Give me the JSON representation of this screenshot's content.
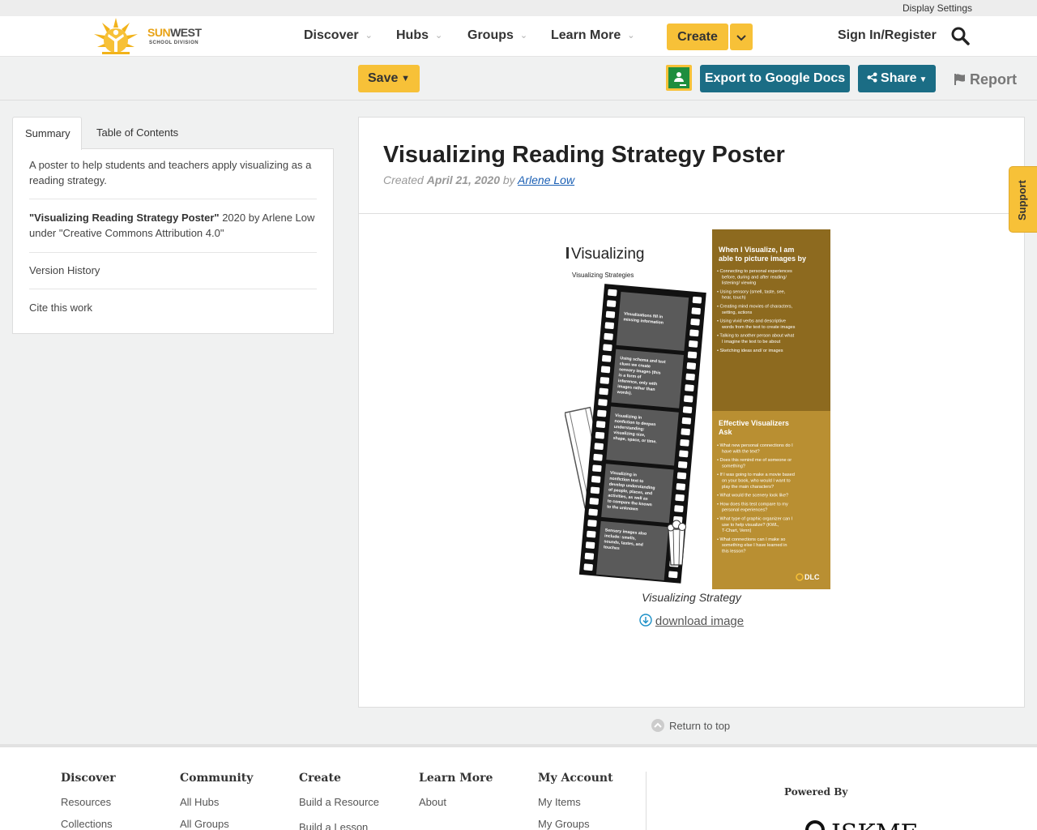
{
  "util_bar": {
    "display_settings": "Display Settings"
  },
  "header": {
    "brand_sun": "SUN",
    "brand_west": "WEST",
    "brand_sub": "SCHOOL DIVISION",
    "nav": [
      {
        "label": "Discover"
      },
      {
        "label": "Hubs"
      },
      {
        "label": "Groups"
      },
      {
        "label": "Learn More"
      }
    ],
    "create_label": "Create",
    "signin_label": "Sign In/Register"
  },
  "toolbar": {
    "save_label": "Save",
    "export_label": "Export to Google Docs",
    "share_label": "Share",
    "report_label": "Report"
  },
  "sidebar": {
    "tabs": [
      {
        "label": "Summary",
        "active": true
      },
      {
        "label": "Table of Contents",
        "active": false
      }
    ],
    "summary": "A poster to help students and teachers apply visualizing as a reading strategy.",
    "attribution_title": "\"Visualizing Reading Strategy Poster\"",
    "attribution_rest": " 2020 by Arlene Low under \"Creative Commons Attribution 4.0\"",
    "version_history": "Version History",
    "cite": "Cite this work"
  },
  "main": {
    "title": "Visualizing Reading Strategy Poster",
    "created_prefix": "Created ",
    "created_date": "April 21, 2020",
    "by": " by ",
    "author": "Arlene Low",
    "image_caption": "Visualizing Strategy",
    "download_label": "download image",
    "return_top": "Return to top"
  },
  "poster": {
    "title": "Visualizing",
    "subtitle": "Visualizing Strategies",
    "film_frames": [
      "Visualizations fill in missing information",
      "Using schema and text clues we create sensory images (this is a form of inference, only with images rather than words).",
      "Visualizing in nonfiction to deepen understanding: visualizing size, shape, space, or time.",
      "Visualizing in nonfiction text to develop understanding of people, places, and activities, as well as to compare the known to the unknown",
      "Sensory images also include: smells, sounds, tastes, and touches"
    ],
    "panel1_heading": "When I Visualize, I am able to picture images by",
    "panel1_items": [
      "Connecting to personal experiences before, during and after reading/ listening/ viewing",
      "Using sensory (smell, taste, see, hear, touch)",
      "Creating mind movies of characters, setting, actions",
      "Using vivid verbs and descriptive words from the text to create images",
      "Talking to another person about what I imagine the text to be about",
      "Sketching ideas and/ or images"
    ],
    "panel2_heading": "Effective Visualizers Ask",
    "panel2_items": [
      "What new personal connections do I have with the text?",
      "Does this remind me of someone or something?",
      "If I was going to make a movie based on your book, who would I want to play the main characters?",
      "What would the scenery look like?",
      "How does this test compare to my personal experiences?",
      "What type of graphic organizer can I use to help visualize? (KWL, T-Chart, Venn)",
      "What connections can I make so something else I have learned in this lesson?"
    ],
    "badge": "DLC",
    "panel1_color": "#8d6a1f",
    "panel2_color": "#b98f32"
  },
  "support_label": "Support",
  "footer": {
    "columns": [
      {
        "heading": "Discover",
        "links": [
          "Resources",
          "Collections"
        ]
      },
      {
        "heading": "Community",
        "links": [
          "All Hubs",
          "All Groups"
        ]
      },
      {
        "heading": "Create",
        "links": [
          "Build a Resource",
          "Build a Lesson"
        ]
      },
      {
        "heading": "Learn More",
        "links": [
          "About"
        ]
      },
      {
        "heading": "My Account",
        "links": [
          "My Items",
          "My Groups"
        ]
      }
    ],
    "powered_by": "Powered By",
    "powered_logo_text": "ISKME"
  },
  "colors": {
    "accent_yellow": "#f7c138",
    "accent_teal": "#1b6d85",
    "link_blue": "#1a5fb4"
  }
}
